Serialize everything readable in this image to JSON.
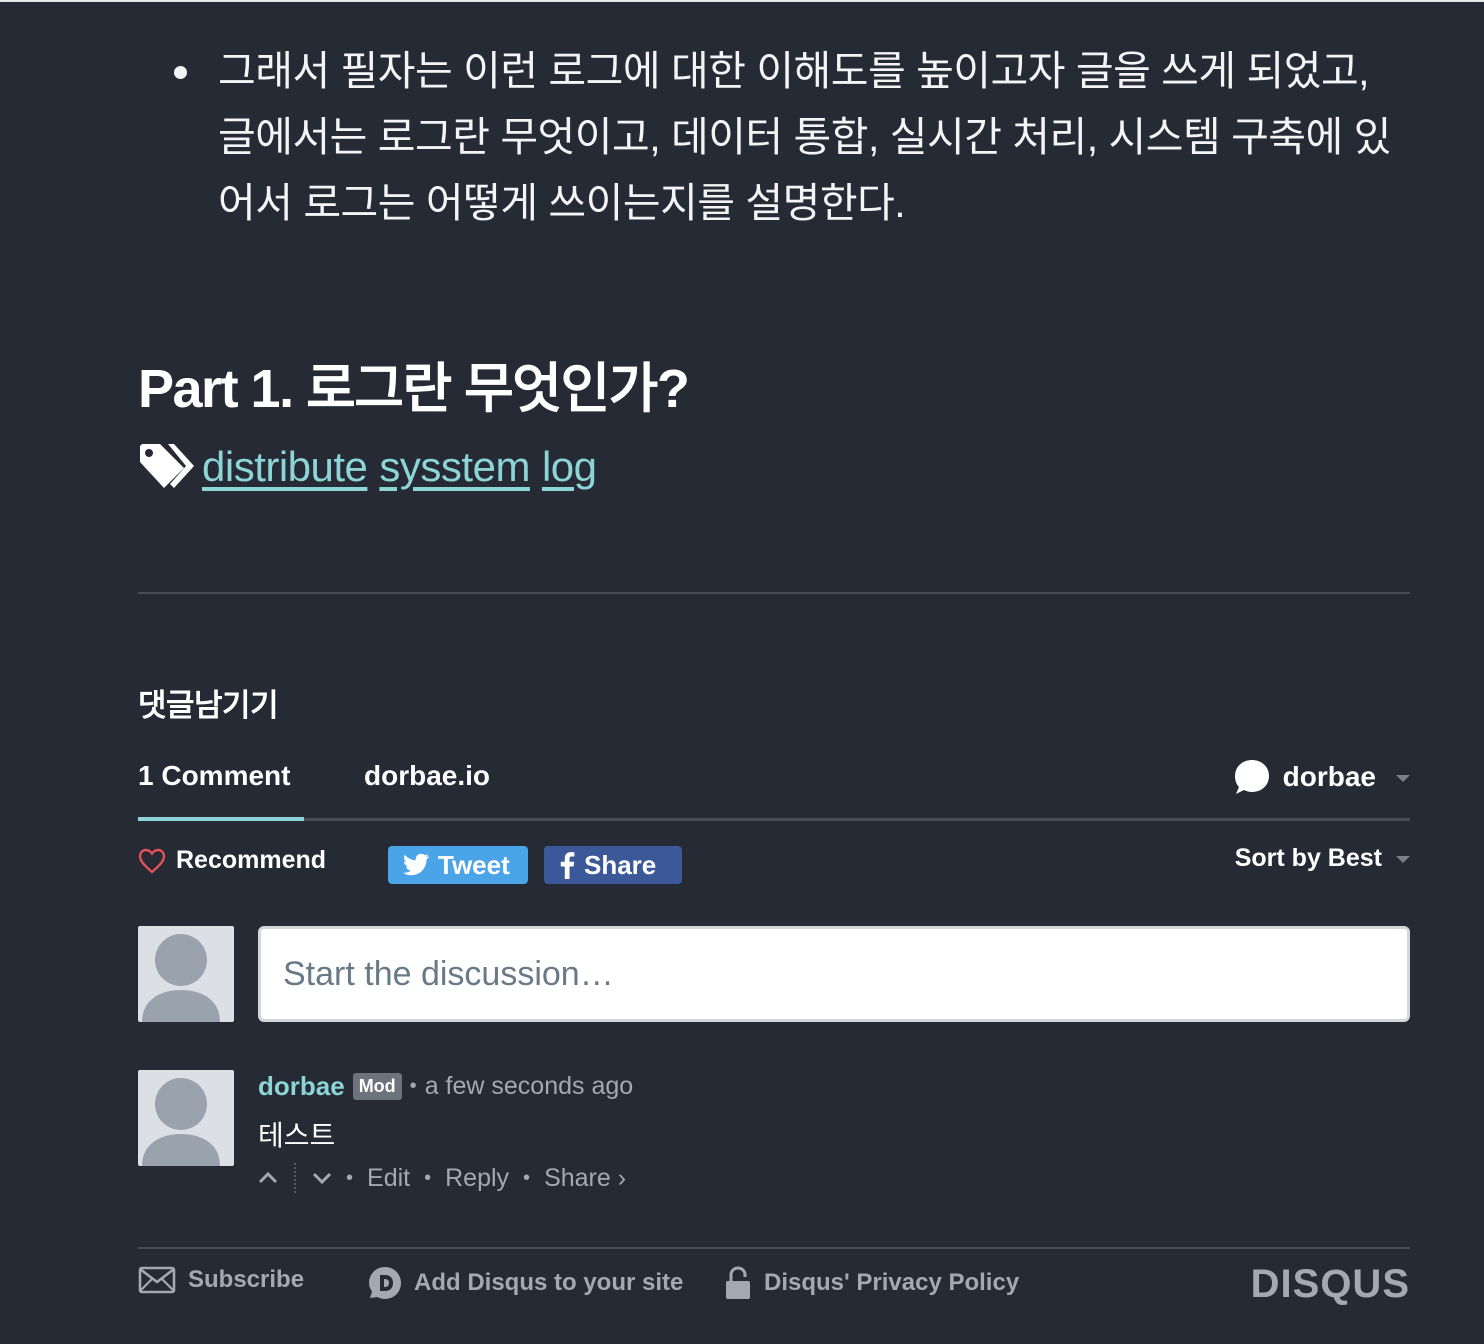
{
  "article": {
    "bullet_lines": [
      "그래서 필자는 이런 로그에 대한 이해도를 높이고자 글을 쓰게 되었고,",
      "글에서는 로그란 무엇이고, 데이터 통합, 실시간 처리, 시스템 구축에 있",
      "어서 로그는 어떻게 쓰이는지를 설명한다."
    ],
    "heading": "Part 1. 로그란 무엇인가?",
    "tags": [
      "distribute",
      "sysstem",
      "log"
    ]
  },
  "comments_section": {
    "title": "댓글남기기"
  },
  "disqus": {
    "nav": {
      "comment_count": "1 Comment",
      "site": "dorbae.io",
      "user": "dorbae"
    },
    "actions": {
      "recommend": "Recommend",
      "tweet": "Tweet",
      "share": "Share",
      "sort": "Sort by Best"
    },
    "compose": {
      "placeholder": "Start the discussion…"
    },
    "post": {
      "author": "dorbae",
      "badge": "Mod",
      "separator": "•",
      "time": "a few seconds ago",
      "body": "테스트",
      "footer": {
        "edit": "Edit",
        "reply": "Reply",
        "share": "Share ›"
      }
    },
    "bottom": {
      "subscribe": "Subscribe",
      "add_disqus": "Add Disqus to your site",
      "privacy": "Disqus' Privacy Policy",
      "logo": "DISQUS"
    }
  },
  "colors": {
    "background": "#252a34",
    "accent": "#8dd4d6",
    "tweet": "#4ba3e8",
    "facebook": "#3b5998",
    "recommend_heart": "#e0525a",
    "muted": "#a3a9b2"
  },
  "icons": [
    "tags-icon",
    "speech-bubble-icon",
    "heart-icon",
    "twitter-bird-icon",
    "facebook-f-icon",
    "upvote-icon",
    "downvote-icon",
    "envelope-icon",
    "disqus-d-icon",
    "lock-icon"
  ]
}
